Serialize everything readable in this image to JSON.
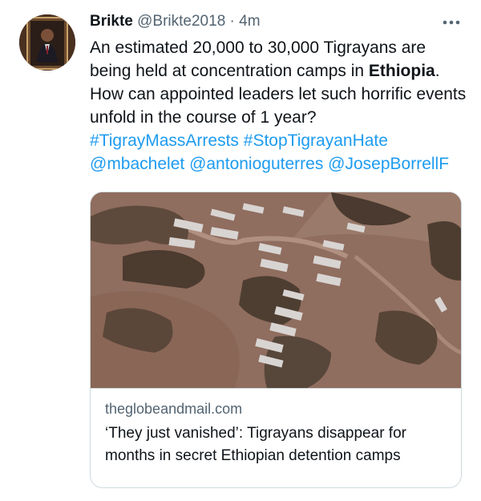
{
  "tweet": {
    "author": {
      "display_name": "Brikte",
      "handle": "@Brikte2018",
      "separator": "·",
      "time": "4m"
    },
    "more_icon": "ellipsis-icon",
    "text": {
      "part1": "An estimated 20,000 to 30,000 Tigrayans are being held at concentration camps in ",
      "bold": "Ethiopia",
      "part2": ". How can appointed leaders let such horrific events unfold in the course of 1 year?",
      "hashtags": [
        "#TigrayMassArrests",
        "#StopTigrayanHate"
      ],
      "mentions": [
        "@mbachelet",
        "@antonioguterres",
        "@JosepBorrellF"
      ]
    },
    "card": {
      "domain": "theglobeandmail.com",
      "title": "‘They just vanished’: Tigrayans disappear for months in secret Ethiopian detention camps"
    },
    "colors": {
      "link": "#1d9bf0",
      "secondary": "#536471",
      "border": "#cfd9de"
    }
  }
}
